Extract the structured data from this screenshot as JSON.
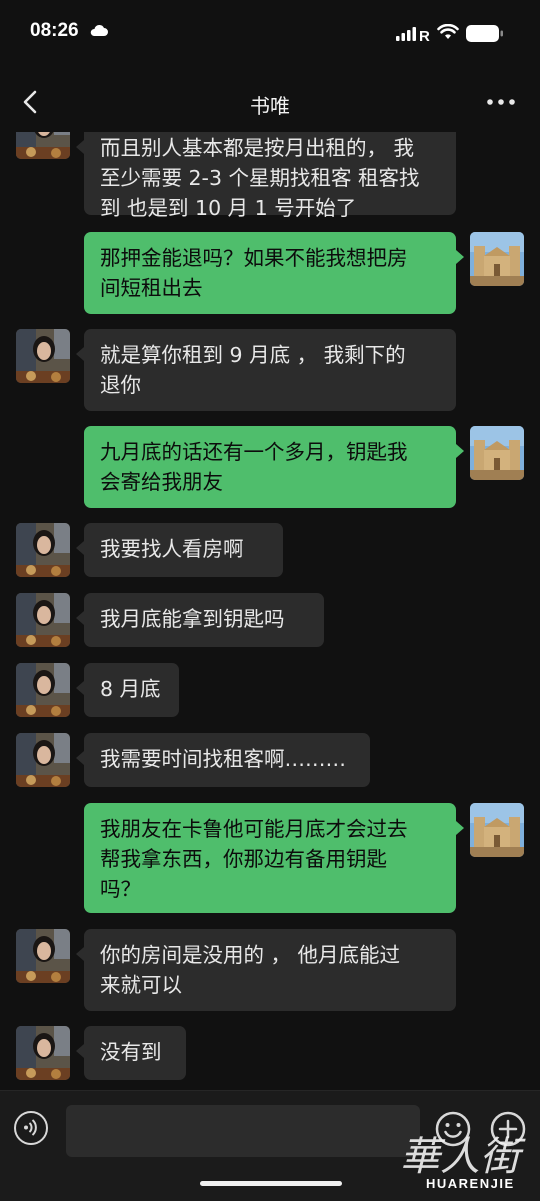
{
  "status_bar": {
    "time": "08:26",
    "carrier_label": "R"
  },
  "header": {
    "title": "书唯"
  },
  "messages": [
    {
      "side": "left",
      "lines": [
        "而且别人基本都是按月出租的， 我",
        "至少需要 2-3 个星期找租客 租客找",
        "到 也是到 10 月 1 号开始了"
      ]
    },
    {
      "side": "right",
      "lines": [
        "那押金能退吗？如果不能我想把房",
        "间短租出去"
      ]
    },
    {
      "side": "left",
      "lines": [
        "就是算你租到 9 月底 ，  我剩下的",
        "退你"
      ]
    },
    {
      "side": "right",
      "lines": [
        "九月底的话还有一个多月，钥匙我",
        "会寄给我朋友"
      ]
    },
    {
      "side": "left",
      "lines": [
        "我要找人看房啊"
      ]
    },
    {
      "side": "left",
      "lines": [
        "我月底能拿到钥匙吗"
      ]
    },
    {
      "side": "left",
      "lines": [
        "8 月底"
      ]
    },
    {
      "side": "left",
      "lines": [
        "我需要时间找租客啊………"
      ]
    },
    {
      "side": "right",
      "lines": [
        "我朋友在卡鲁他可能月底才会过去",
        "帮我拿东西，你那边有备用钥匙",
        "吗？"
      ]
    },
    {
      "side": "left",
      "lines": [
        "你的房间是没用的 ，  他月底能过",
        "来就可以"
      ]
    },
    {
      "side": "left",
      "lines": [
        "没有到"
      ]
    }
  ],
  "input_bar": {
    "text": ""
  },
  "watermark": {
    "glyphs": "華人街",
    "text": "HUARENJIE"
  },
  "colors": {
    "background": "#111111",
    "left_bubble": "#2c2c2c",
    "right_bubble": "#4fbe6c",
    "input_bar": "#1b1b1b"
  },
  "icons": [
    "back-icon",
    "more-icon",
    "voice-icon",
    "emoji-icon",
    "add-icon",
    "cloud-icon",
    "signal-icon",
    "wifi-icon",
    "battery-icon"
  ]
}
